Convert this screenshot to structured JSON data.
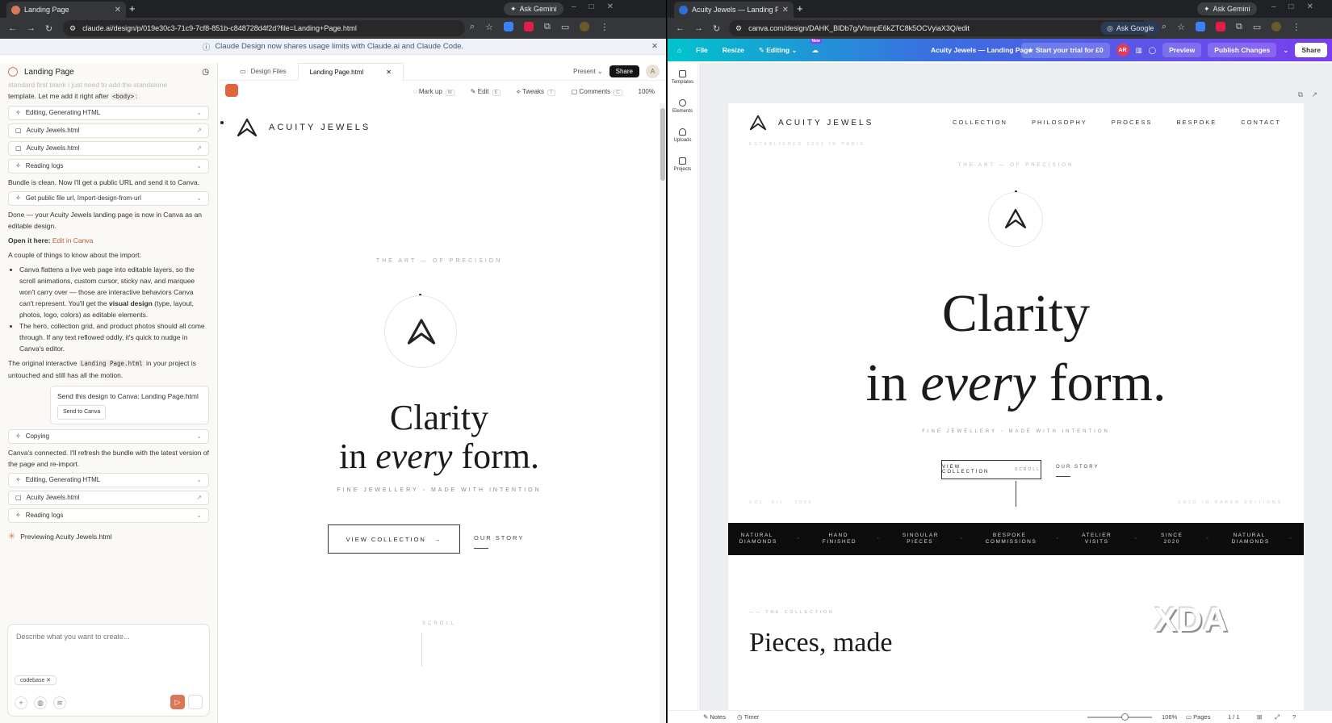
{
  "left_window": {
    "tab_title": "Landing Page",
    "ask_gemini": "Ask Gemini",
    "url": "claude.ai/design/p/019e30c3-71c9-7cf8-851b-c848728d4f2d?file=Landing+Page.html",
    "banner": "Claude Design now shares usage limits with Claude.ai and Claude Code.",
    "chat": {
      "title": "Landing Page",
      "intro_fade": "standard first blank i just need to add the standalone",
      "intro_text": "template. Let me add it right after",
      "intro_code": "<body>",
      "tool1": "Editing, Generating HTML",
      "file1": "Acuity Jewels.html",
      "file2": "Acuity Jewels.html",
      "tool2": "Reading logs",
      "msg1": "Bundle is clean. Now I'll get a public URL and send it to Canva.",
      "tool3": "Get public file url, Import-design-from-url",
      "msg2": "Done — your Acuity Jewels landing page is now in Canva as an editable design.",
      "open_label": "Open it here:",
      "open_link": "Edit in Canva",
      "msg3": "A couple of things to know about the import:",
      "bullet1_a": "Canva flattens a live web page into editable layers, so the scroll animations, custom cursor, sticky nav, and marquee won't carry over — those are interactive behaviors Canva can't represent. You'll get the",
      "bullet1_b": "visual design",
      "bullet1_c": "(type, layout, photos, logo, colors) as editable elements.",
      "bullet2": "The hero, collection grid, and product photos should all come through. If any text reflowed oddly, it's quick to nudge in Canva's editor.",
      "msg4_a": "The original interactive",
      "msg4_code": "Landing Page.html",
      "msg4_b": "in your project is untouched and still has all the motion.",
      "send_prompt": "Send this design to Canva: Landing Page.html",
      "send_btn": "Send to Canva",
      "tool4": "Copying",
      "msg5": "Canva's connected. I'll refresh the bundle with the latest version of the page and re-import.",
      "tool5": "Editing, Generating HTML",
      "file3": "Acuity Jewels.html",
      "tool6": "Reading logs",
      "previewing": "Previewing Acuity Jewels.html",
      "composer_placeholder": "Describe what you want to create...",
      "chip": "codebase"
    },
    "design": {
      "tab_files": "Design Files",
      "tab_active": "Landing Page.html",
      "present": "Present",
      "share": "Share",
      "avatar": "A",
      "tools": [
        "Mark up",
        "Edit",
        "Tweaks",
        "Comments"
      ],
      "tool_keys": [
        "M",
        "E",
        "T",
        "C"
      ],
      "zoom": "100%",
      "brand": "ACUITY JEWELS",
      "kicker": "THE ART — OF PRECISION",
      "hero_line1": "Clarity",
      "hero_line2_a": "in",
      "hero_line2_em": "every",
      "hero_line2_b": "form.",
      "tagline": "FINE JEWELLERY  ◦  MADE WITH INTENTION",
      "cta": "VIEW COLLECTION",
      "story": "OUR STORY",
      "scroll": "SCROLL"
    }
  },
  "right_window": {
    "tab_title": "Acuity Jewels — Landing Page",
    "ask_gemini": "Ask Gemini",
    "url": "canva.com/design/DAHK_BlDb7g/VhmpE6kZTC8k5OCVyiaX3Q/edit",
    "ask_google": "Ask Google",
    "canva": {
      "menu": [
        "File",
        "Resize",
        "Editing"
      ],
      "new_badge": "New",
      "doc_title": "Acuity Jewels — Landing Page",
      "trial": "Start your trial for £0",
      "avatar": "AR",
      "preview": "Preview",
      "publish": "Publish Changes",
      "share": "Share",
      "side": [
        "Templates",
        "Elements",
        "Uploads",
        "Projects"
      ],
      "brand": "ACUITY JEWELS",
      "nav": [
        "COLLECTION",
        "PHILOSOPHY",
        "PROCESS",
        "BESPOKE",
        "CONTACT"
      ],
      "established": "ESTABLISHED 2003 IN PARIS",
      "kicker": "THE ART — OF PRECISION",
      "hero_line1": "Clarity",
      "hero_line2_a": "in",
      "hero_line2_em": "every",
      "hero_line2_b": "form.",
      "tagline": "FINE JEWELLERY  ◦  MADE WITH INTENTION",
      "cta": "VIEW COLLECTION",
      "cta_overlap": "SCROLL",
      "story": "OUR STORY",
      "vol": "VOL. XII · 2026",
      "edition": "SOLD IN RARER EDITIONS",
      "marquee": [
        "NATURAL DIAMONDS",
        "HAND FINISHED",
        "SINGULAR PIECES",
        "BESPOKE COMMISSIONS",
        "ATELIER VISITS",
        "SINCE 2020",
        "NATURAL DIAMONDS"
      ],
      "section_kicker": "THE COLLECTION",
      "section_title": "Pieces, made",
      "bottom": {
        "notes": "Notes",
        "timer": "Timer",
        "zoom": "106%",
        "pages": "Pages",
        "page_count": "1 / 1"
      }
    }
  },
  "watermark": "XDA"
}
